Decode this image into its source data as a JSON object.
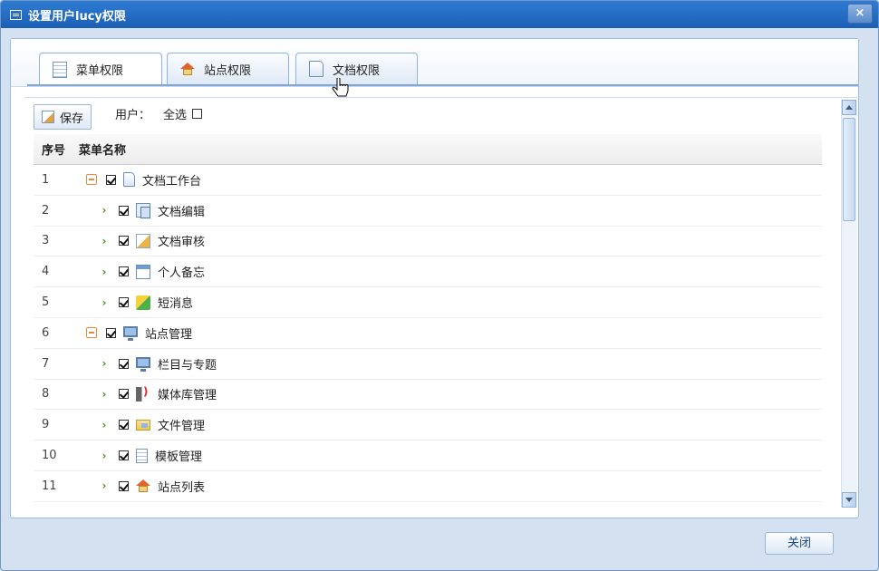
{
  "window": {
    "title": "设置用户lucy权限",
    "close_label": "×"
  },
  "tabs": [
    {
      "label": "菜单权限",
      "icon": "table-icon"
    },
    {
      "label": "站点权限",
      "icon": "house-icon"
    },
    {
      "label": "文档权限",
      "icon": "document-icon"
    }
  ],
  "toolbar": {
    "save_label": "保存",
    "user_label": "用户：",
    "select_all_label": "全选",
    "select_all_checked": false
  },
  "grid": {
    "headers": [
      "序号",
      "菜单名称"
    ],
    "rows": [
      {
        "idx": "1",
        "name": "文档工作台",
        "level": 0,
        "expander": "collapse",
        "checked": true,
        "icon": "document-icon"
      },
      {
        "idx": "2",
        "name": "文档编辑",
        "level": 1,
        "expander": "arrow",
        "checked": true,
        "icon": "documents-icon"
      },
      {
        "idx": "3",
        "name": "文档审核",
        "level": 1,
        "expander": "arrow",
        "checked": true,
        "icon": "edit-icon"
      },
      {
        "idx": "4",
        "name": "个人备忘",
        "level": 1,
        "expander": "arrow",
        "checked": true,
        "icon": "calendar-icon"
      },
      {
        "idx": "5",
        "name": "短消息",
        "level": 1,
        "expander": "arrow",
        "checked": true,
        "icon": "message-icon"
      },
      {
        "idx": "6",
        "name": "站点管理",
        "level": 0,
        "expander": "collapse",
        "checked": true,
        "icon": "monitor-icon"
      },
      {
        "idx": "7",
        "name": "栏目与专题",
        "level": 1,
        "expander": "arrow",
        "checked": true,
        "icon": "monitor-icon"
      },
      {
        "idx": "8",
        "name": "媒体库管理",
        "level": 1,
        "expander": "arrow",
        "checked": true,
        "icon": "speaker-icon"
      },
      {
        "idx": "9",
        "name": "文件管理",
        "level": 1,
        "expander": "arrow",
        "checked": true,
        "icon": "folder-icon"
      },
      {
        "idx": "10",
        "name": "模板管理",
        "level": 1,
        "expander": "arrow",
        "checked": true,
        "icon": "table-icon"
      },
      {
        "idx": "11",
        "name": "站点列表",
        "level": 1,
        "expander": "arrow",
        "checked": true,
        "icon": "house-icon"
      }
    ]
  },
  "footer": {
    "close_label": "关闭"
  }
}
